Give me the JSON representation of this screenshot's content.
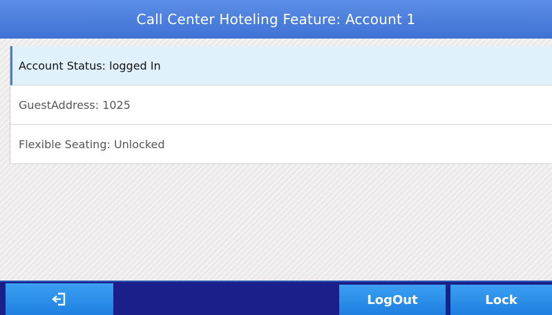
{
  "header": {
    "title": "Call Center Hoteling Feature: Account  1"
  },
  "list": {
    "items": [
      {
        "label": "Account Status: logged In"
      },
      {
        "label": "GuestAddress: 1025"
      },
      {
        "label": "Flexible Seating: Unlocked"
      }
    ]
  },
  "softkeys": {
    "back_icon": "exit-icon",
    "logout_label": "LogOut",
    "lock_label": "Lock"
  },
  "colors": {
    "titlebar": "#4a7fdd",
    "softkey_bar": "#1a1f8a",
    "softkey_button": "#2b8ce8",
    "selected_row": "#e1f1fc"
  }
}
